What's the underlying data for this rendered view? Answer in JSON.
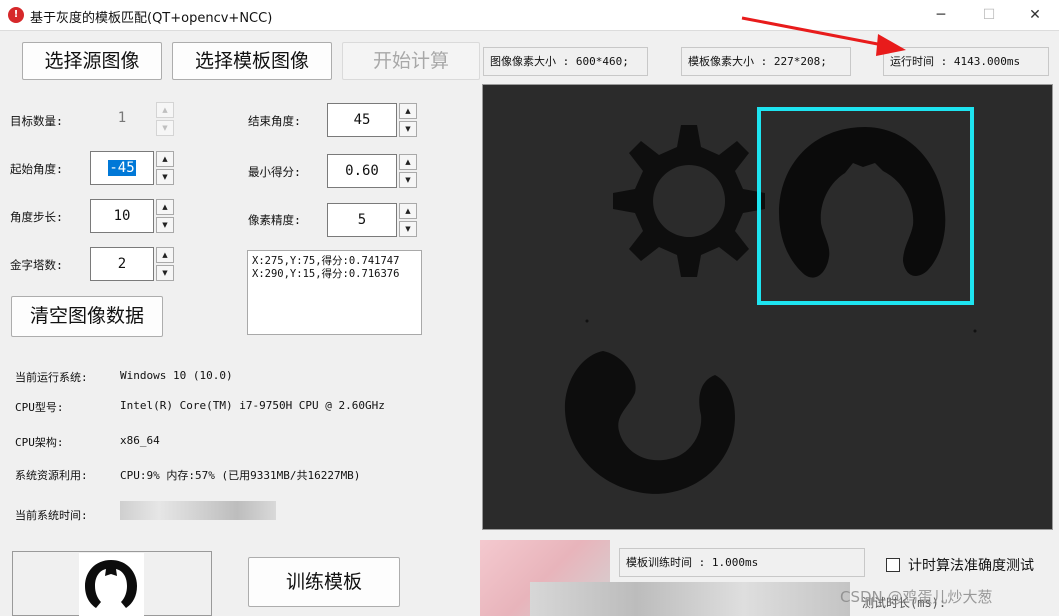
{
  "window": {
    "title": "基于灰度的模板匹配(QT+opencv+NCC)",
    "icon": "app-logo-icon",
    "controls": {
      "minimize": "─",
      "maximize": "☐",
      "close": "✕"
    }
  },
  "toolbar": {
    "select_source": "选择源图像",
    "select_template": "选择模板图像",
    "start": "开始计算"
  },
  "info": {
    "image_size": "图像像素大小 : 600*460;",
    "template_size": "模板像素大小 : 227*208;",
    "run_time": "运行时间 : 4143.000ms"
  },
  "params": {
    "target_count": {
      "label": "目标数量:",
      "value": "1"
    },
    "start_angle": {
      "label": "起始角度:",
      "value": "-45"
    },
    "angle_step": {
      "label": "角度步长:",
      "value": "10"
    },
    "pyramid": {
      "label": "金字塔数:",
      "value": "2"
    },
    "end_angle": {
      "label": "结束角度:",
      "value": "45"
    },
    "min_score": {
      "label": "最小得分:",
      "value": "0.60"
    },
    "pixel_precision": {
      "label": "像素精度:",
      "value": "5"
    }
  },
  "results": [
    "X:275,Y:75,得分:0.741747",
    "X:290,Y:15,得分:0.716376"
  ],
  "clear_button": "清空图像数据",
  "system": {
    "os_label": "当前运行系统:",
    "os_value": "Windows 10 (10.0)",
    "cpu_label": "CPU型号:",
    "cpu_value": "Intel(R) Core(TM) i7-9750H CPU @ 2.60GHz",
    "arch_label": "CPU架构:",
    "arch_value": "x86_64",
    "res_label": "系统资源利用:",
    "res_value": "CPU:9% 内存:57% (已用9331MB/共16227MB)",
    "time_label": "当前系统时间:"
  },
  "train_button": "训练模板",
  "train_time": "模板训练时间 : 1.000ms",
  "accuracy_test": {
    "label": "计时算法准确度测试",
    "checked": false
  },
  "test_duration_label": "测试时长(ms):",
  "watermark": "CSDN @鸡蛋儿炒大葱",
  "colors": {
    "match_box": "#1ee4f0",
    "canvas_bg": "#2b2b2b",
    "annotation_arrow": "#e81b1b",
    "selection": "#0078d7"
  }
}
